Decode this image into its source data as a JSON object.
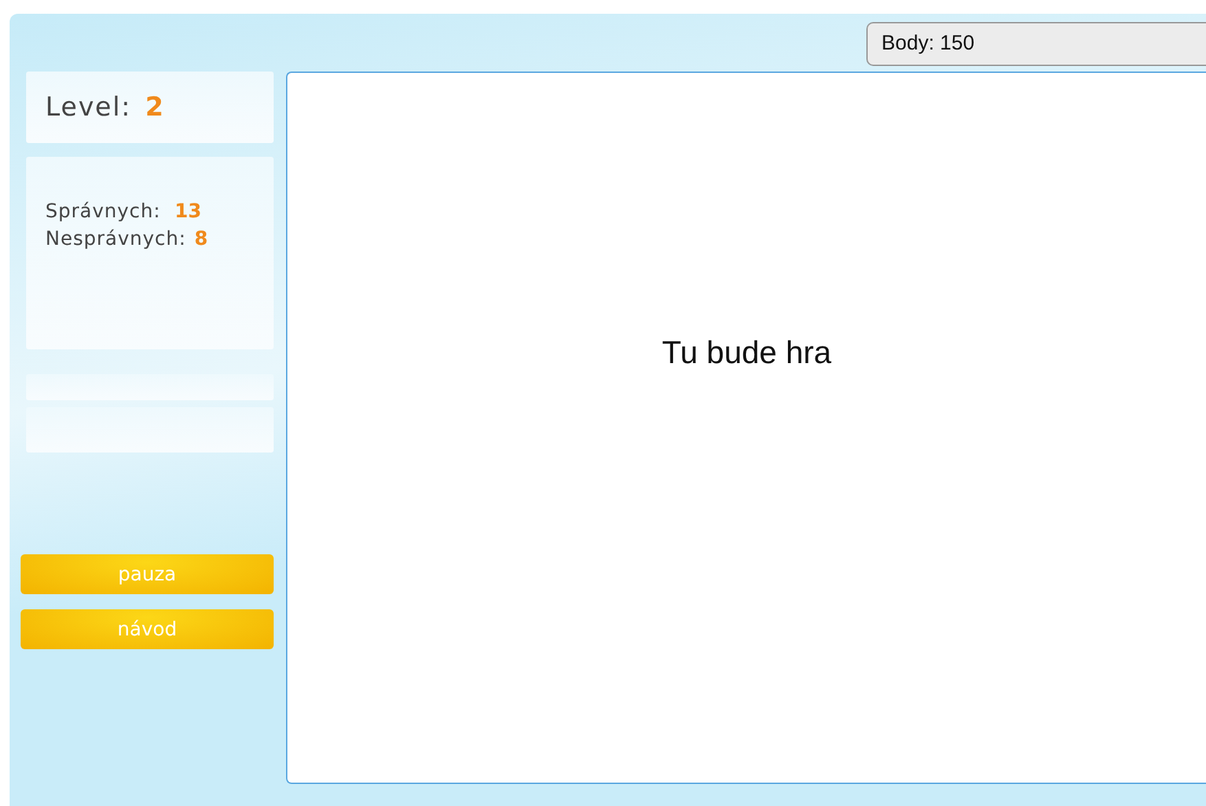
{
  "score_field": {
    "value": "Body: 150"
  },
  "level": {
    "label": "Level:",
    "value": "2"
  },
  "stats": [
    {
      "label": "Správnych:",
      "value": "13"
    },
    {
      "label": "Nesprávnych:",
      "value": "8"
    }
  ],
  "buttons": [
    "pauza",
    "návod"
  ],
  "game_area": {
    "text": "Tu bude hra"
  }
}
